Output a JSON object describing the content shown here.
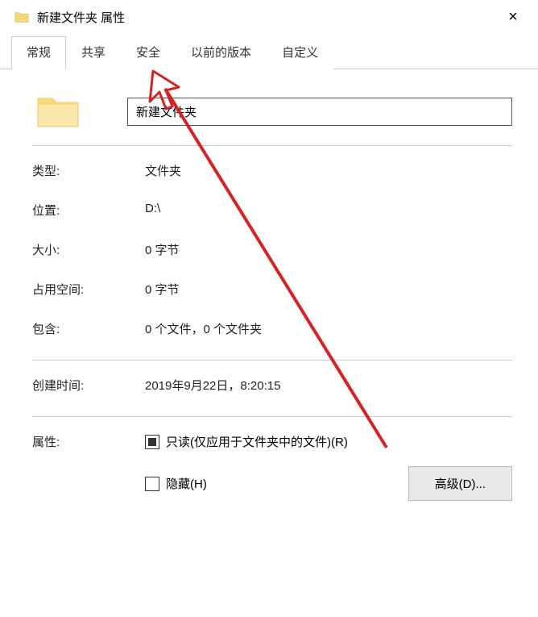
{
  "titlebar": {
    "title": "新建文件夹 属性"
  },
  "tabs": {
    "general": "常规",
    "sharing": "共享",
    "security": "安全",
    "previous_versions": "以前的版本",
    "customize": "自定义"
  },
  "name_field": {
    "value": "新建文件夹"
  },
  "fields": {
    "type_label": "类型:",
    "type_value": "文件夹",
    "location_label": "位置:",
    "location_value": "D:\\",
    "size_label": "大小:",
    "size_value": "0 字节",
    "size_on_disk_label": "占用空间:",
    "size_on_disk_value": "0 字节",
    "contains_label": "包含:",
    "contains_value": "0 个文件，0 个文件夹",
    "created_label": "创建时间:",
    "created_value": "2019年9月22日，8:20:15"
  },
  "attributes": {
    "label": "属性:",
    "readonly_label": "只读(仅应用于文件夹中的文件)(R)",
    "hidden_label": "隐藏(H)",
    "advanced_button": "高级(D)..."
  }
}
